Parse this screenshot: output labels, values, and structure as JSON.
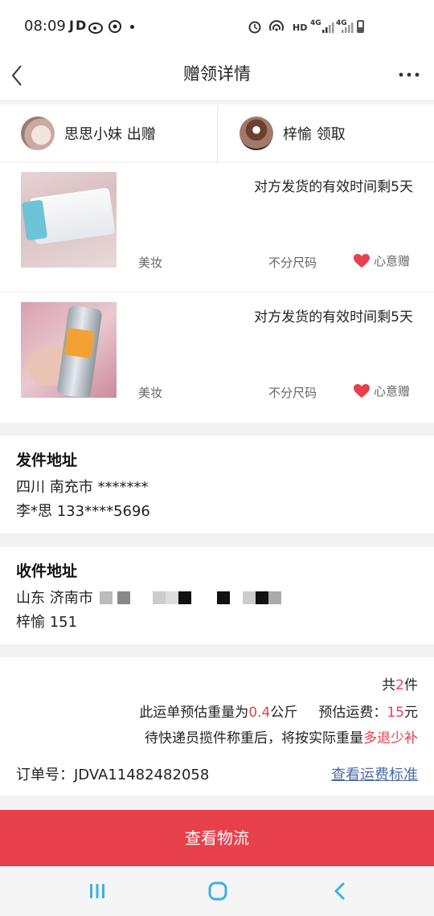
{
  "status_bar": {
    "time": "08:09",
    "left_icons": "JD",
    "network_label_1": "HD",
    "network_label_2": "4G",
    "network_label_3": "4G"
  },
  "nav": {
    "title": "赠领详情"
  },
  "parties": {
    "giver_label": "思思小妹 出赠",
    "receiver_label": "梓愉 领取"
  },
  "items": [
    {
      "deadline": "对方发货的有效时间剩5天",
      "category": "美妆",
      "size": "不分尺码",
      "tag": "心意赠"
    },
    {
      "deadline": "对方发货的有效时间剩5天",
      "category": "美妆",
      "size": "不分尺码",
      "tag": "心意赠"
    }
  ],
  "sender": {
    "title": "发件地址",
    "region": "四川 南充市 *******",
    "contact": "李*思 133****5696"
  },
  "receiver": {
    "title": "收件地址",
    "region": "山东 济南市",
    "contact": "梓愉 151"
  },
  "order": {
    "count_prefix": "共",
    "count": "2",
    "count_suffix": "件",
    "weight_prefix": "此运单预估重量为",
    "weight": "0.4",
    "weight_suffix": "公斤",
    "fee_prefix": "预估运费：",
    "fee": "15",
    "fee_suffix": "元",
    "note_prefix": "待快递员揽件称重后，将按实际重量",
    "note_highlight": "多退少补",
    "order_id": "订单号：JDVA11482482058",
    "fee_standard_link": "查看运费标准"
  },
  "actions": {
    "view_logistics": "查看物流"
  },
  "colors": {
    "accent": "#e8404a",
    "link": "#4a6aa5",
    "nav_icons": "#3ab0e6"
  }
}
